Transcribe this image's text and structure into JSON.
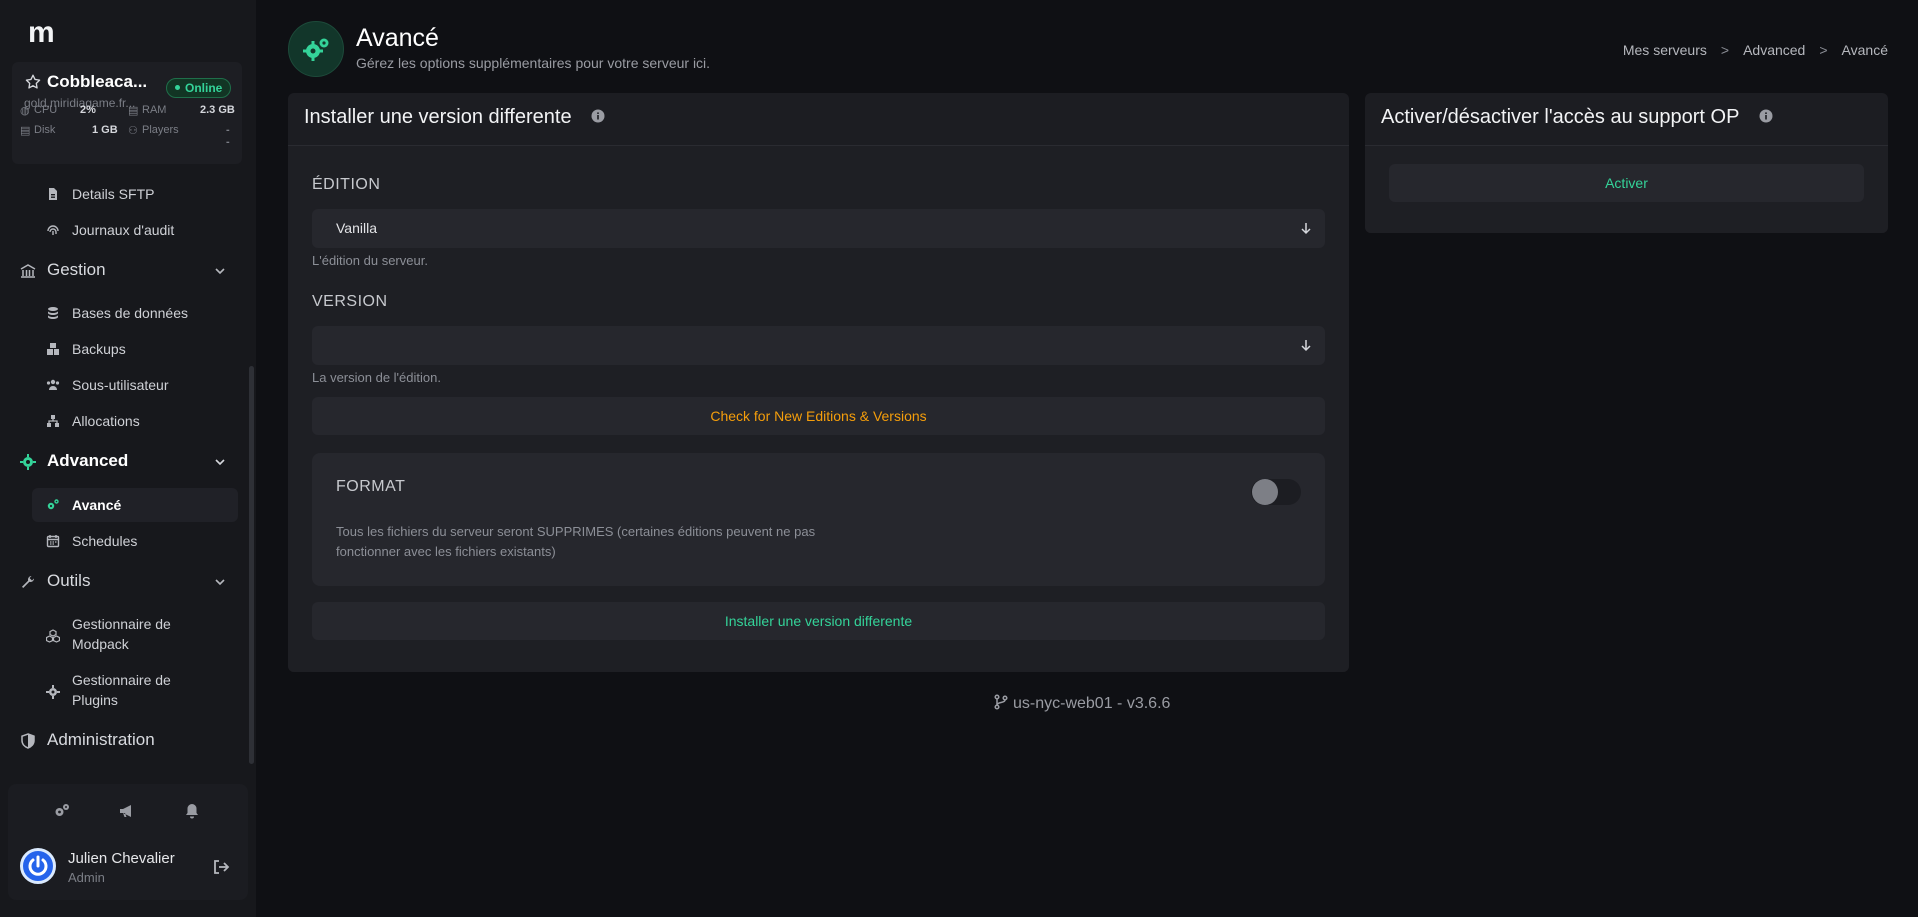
{
  "sidebar": {
    "logo": "m",
    "server": {
      "name": "Cobbleaca...",
      "host": "gold.miridiagame.fr...",
      "status": "Online",
      "stats": {
        "cpu_label": "CPU",
        "cpu_value": "2%",
        "ram_label": "RAM",
        "ram_value": "2.3 GB",
        "disk_label": "Disk",
        "disk_value": "1 GB",
        "players_label": "Players",
        "players_value": "--"
      }
    },
    "items": {
      "sftp": "Details SFTP",
      "audit": "Journaux d'audit",
      "gestion": "Gestion",
      "databases": "Bases de données",
      "backups": "Backups",
      "subusers": "Sous-utilisateur",
      "allocations": "Allocations",
      "advanced": "Advanced",
      "avance": "Avancé",
      "schedules": "Schedules",
      "outils": "Outils",
      "modpack": "Gestionnaire de Modpack",
      "plugins": "Gestionnaire de Plugins",
      "administration": "Administration"
    },
    "user": {
      "name": "Julien Chevalier",
      "role": "Admin"
    }
  },
  "header": {
    "title": "Avancé",
    "subtitle": "Gérez les options supplémentaires pour votre serveur ici.",
    "breadcrumb": [
      "Mes serveurs",
      "Advanced",
      "Avancé"
    ],
    "separator": ">"
  },
  "install_panel": {
    "title": "Installer une version differente",
    "edition_label": "ÉDITION",
    "edition_value": "Vanilla",
    "edition_help": "L'édition du serveur.",
    "version_label": "VERSION",
    "version_value": "",
    "version_help": "La version de l'édition.",
    "check_button": "Check for New Editions & Versions",
    "format_title": "FORMAT",
    "format_desc": "Tous les fichiers du serveur seront SUPPRIMES (certaines éditions peuvent ne pas fonctionner avec les fichiers existants)",
    "format_enabled": false,
    "install_button": "Installer une version differente"
  },
  "op_panel": {
    "title": "Activer/désactiver l'accès au support OP",
    "button": "Activer"
  },
  "footer": {
    "version": "us-nyc-web01 - v3.6.6"
  },
  "colors": {
    "accent": "#34d399",
    "warning": "#f59e0b",
    "background": "#0f1014"
  }
}
